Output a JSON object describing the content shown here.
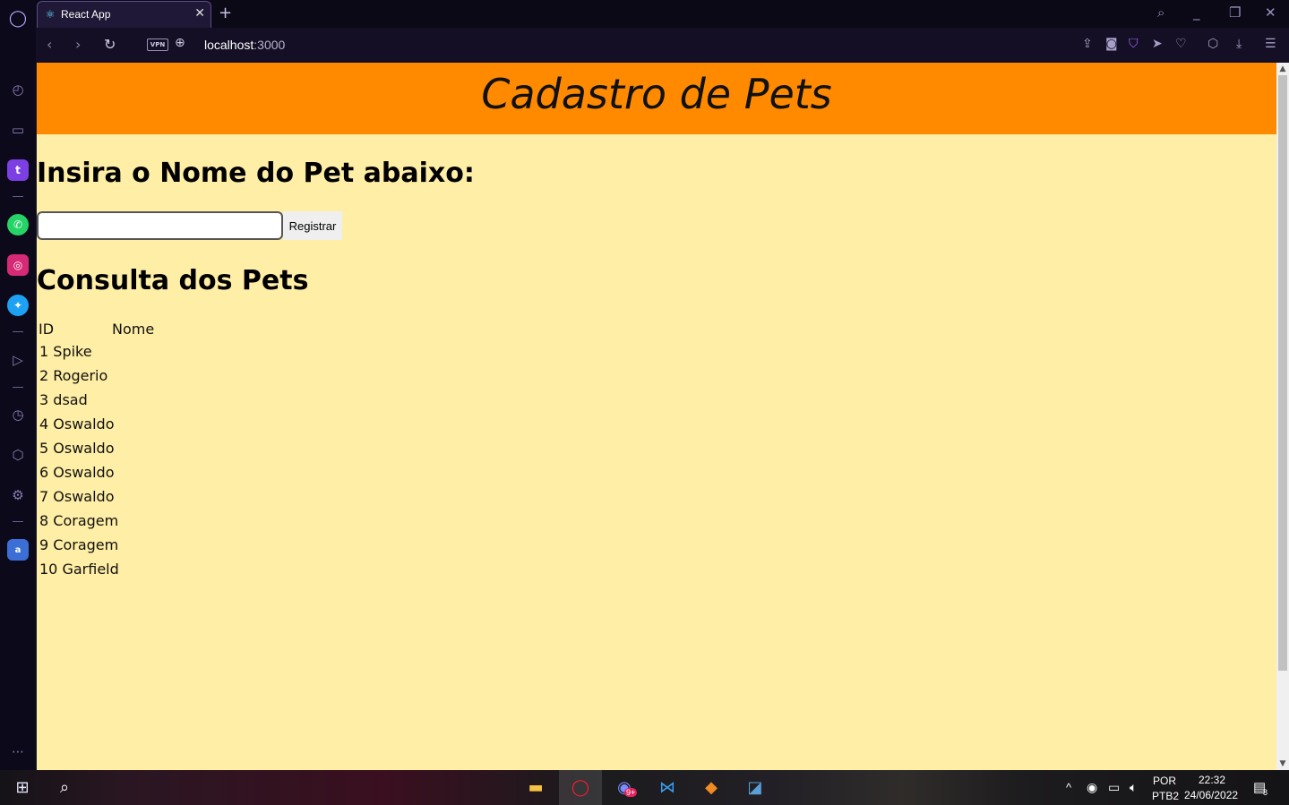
{
  "browser": {
    "tab_title": "React App",
    "tab_close": "✕",
    "new_tab": "+",
    "url_host": "localhost",
    "url_port": ":3000",
    "vpn_badge": "VPN"
  },
  "page": {
    "header_title": "Cadastro de Pets",
    "form_heading": "Insira o Nome do Pet abaixo:",
    "input_value": "",
    "register_label": "Registrar",
    "list_heading": "Consulta dos Pets",
    "table": {
      "headers": [
        "ID",
        "Nome"
      ],
      "rows": [
        [
          "1",
          "Spike"
        ],
        [
          "2",
          "Rogerio"
        ],
        [
          "3",
          "dsad"
        ],
        [
          "4",
          "Oswaldo"
        ],
        [
          "5",
          "Oswaldo"
        ],
        [
          "6",
          "Oswaldo"
        ],
        [
          "7",
          "Oswaldo"
        ],
        [
          "8",
          "Coragem"
        ],
        [
          "9",
          "Coragem"
        ],
        [
          "10",
          "Garfield"
        ]
      ]
    }
  },
  "taskbar": {
    "lang_top": "POR",
    "lang_bottom": "PTB2",
    "time": "22:32",
    "date": "24/06/2022",
    "notifications": "8",
    "discord_badge": "9+"
  },
  "colors": {
    "header_bg": "#ff8a00",
    "page_bg": "#ffeea5"
  }
}
